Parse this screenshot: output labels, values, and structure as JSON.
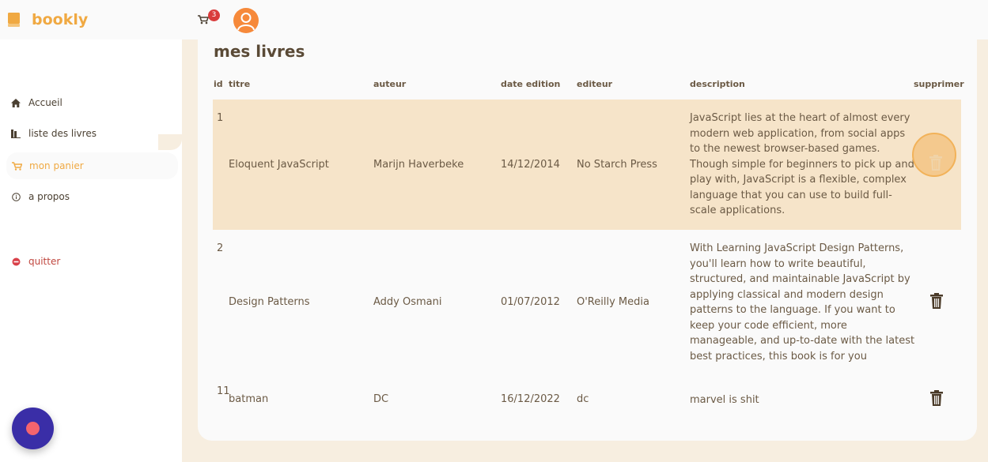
{
  "brand": {
    "name": "bookly"
  },
  "header": {
    "cart_count": "3"
  },
  "sidebar": {
    "items": [
      {
        "label": "Accueil",
        "icon": "home-icon"
      },
      {
        "label": "liste des livres",
        "icon": "books-icon"
      },
      {
        "label": "mon panier",
        "icon": "cart-icon",
        "active": true
      },
      {
        "label": "a propos",
        "icon": "info-icon"
      },
      {
        "label": "quitter",
        "icon": "exit-icon"
      }
    ]
  },
  "main": {
    "title": "mes livres",
    "columns": [
      "id",
      "titre",
      "auteur",
      "date edition",
      "editeur",
      "description",
      "supprimer"
    ],
    "rows": [
      {
        "id": "1",
        "titre": "Eloquent JavaScript",
        "auteur": "Marijn Haverbeke",
        "date": "14/12/2014",
        "editeur": "No Starch Press",
        "description": "JavaScript lies at the heart of almost every modern web application, from social apps to the newest browser-based games. Though simple for beginners to pick up and play with, JavaScript is a flexible, complex language that you can use to build full-scale applications."
      },
      {
        "id": "2",
        "titre": "Design Patterns",
        "auteur": "Addy Osmani",
        "date": "01/07/2012",
        "editeur": "O'Reilly Media",
        "description": "With Learning JavaScript Design Patterns, you'll learn how to write beautiful, structured, and maintainable JavaScript by applying classical and modern design patterns to the language. If you want to keep your code efficient, more manageable, and up-to-date with the latest best practices, this book is for you"
      },
      {
        "id": "11",
        "titre": "batman",
        "auteur": "DC",
        "date": "16/12/2022",
        "editeur": "dc",
        "description": "marvel is shit"
      }
    ]
  },
  "colors": {
    "accent": "#f0a942",
    "highlight_row": "#f6e4c9",
    "background": "#f7eee0",
    "quit": "#c0473f",
    "fab": "#3a2ea7"
  }
}
